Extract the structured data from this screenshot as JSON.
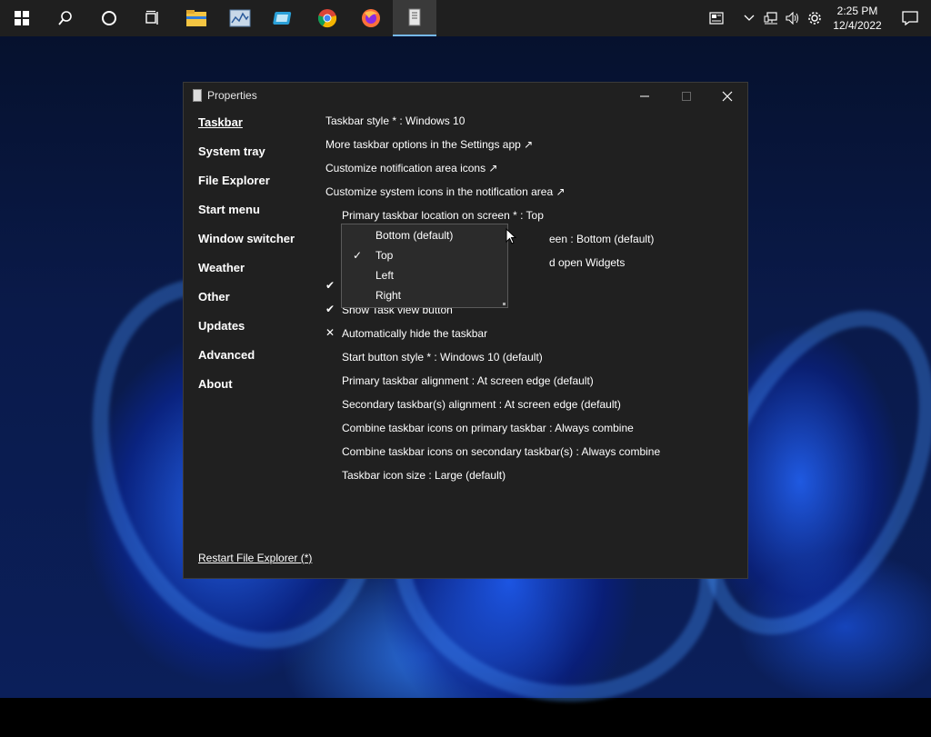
{
  "taskbar": {
    "clock_time": "2:25 PM",
    "clock_date": "12/4/2022",
    "apps": [
      "start-icon",
      "search-icon",
      "cortana-icon",
      "task-view-icon",
      "file-explorer-icon",
      "resource-monitor-icon",
      "app-icon",
      "chrome-icon",
      "firefox-icon",
      "properties-app-icon"
    ]
  },
  "window": {
    "title": "Properties",
    "nav": [
      "Taskbar",
      "System tray",
      "File Explorer",
      "Start menu",
      "Window switcher",
      "Weather",
      "Other",
      "Updates",
      "Advanced",
      "About"
    ],
    "active_nav": "Taskbar",
    "restart_label": "Restart File Explorer (*)"
  },
  "options": {
    "taskbar_style": "Taskbar style * : Windows 10",
    "more_options": "More taskbar options in the Settings app ↗",
    "notif_icons": "Customize notification area icons ↗",
    "system_icons": "Customize system icons in the notification area ↗",
    "primary_location": "Primary taskbar location on screen * : Top",
    "secondary_location_partial": "een : Bottom (default)",
    "widgets_partial": "d open Widgets",
    "task_view": "Show Task view button",
    "auto_hide": "Automatically hide the taskbar",
    "start_style": "Start button style * : Windows 10 (default)",
    "primary_align": "Primary taskbar alignment : At screen edge (default)",
    "secondary_align": "Secondary taskbar(s) alignment : At screen edge (default)",
    "combine_primary": "Combine taskbar icons on primary taskbar : Always combine",
    "combine_secondary": "Combine taskbar icons on secondary taskbar(s) : Always combine",
    "icon_size": "Taskbar icon size : Large (default)"
  },
  "dropdown": {
    "items": [
      "Bottom (default)",
      "Top",
      "Left",
      "Right"
    ],
    "selected": "Top"
  },
  "colors": {
    "window_bg": "#202020",
    "taskbar_bg": "#1f1f1f",
    "accent": "#76b9ed"
  }
}
